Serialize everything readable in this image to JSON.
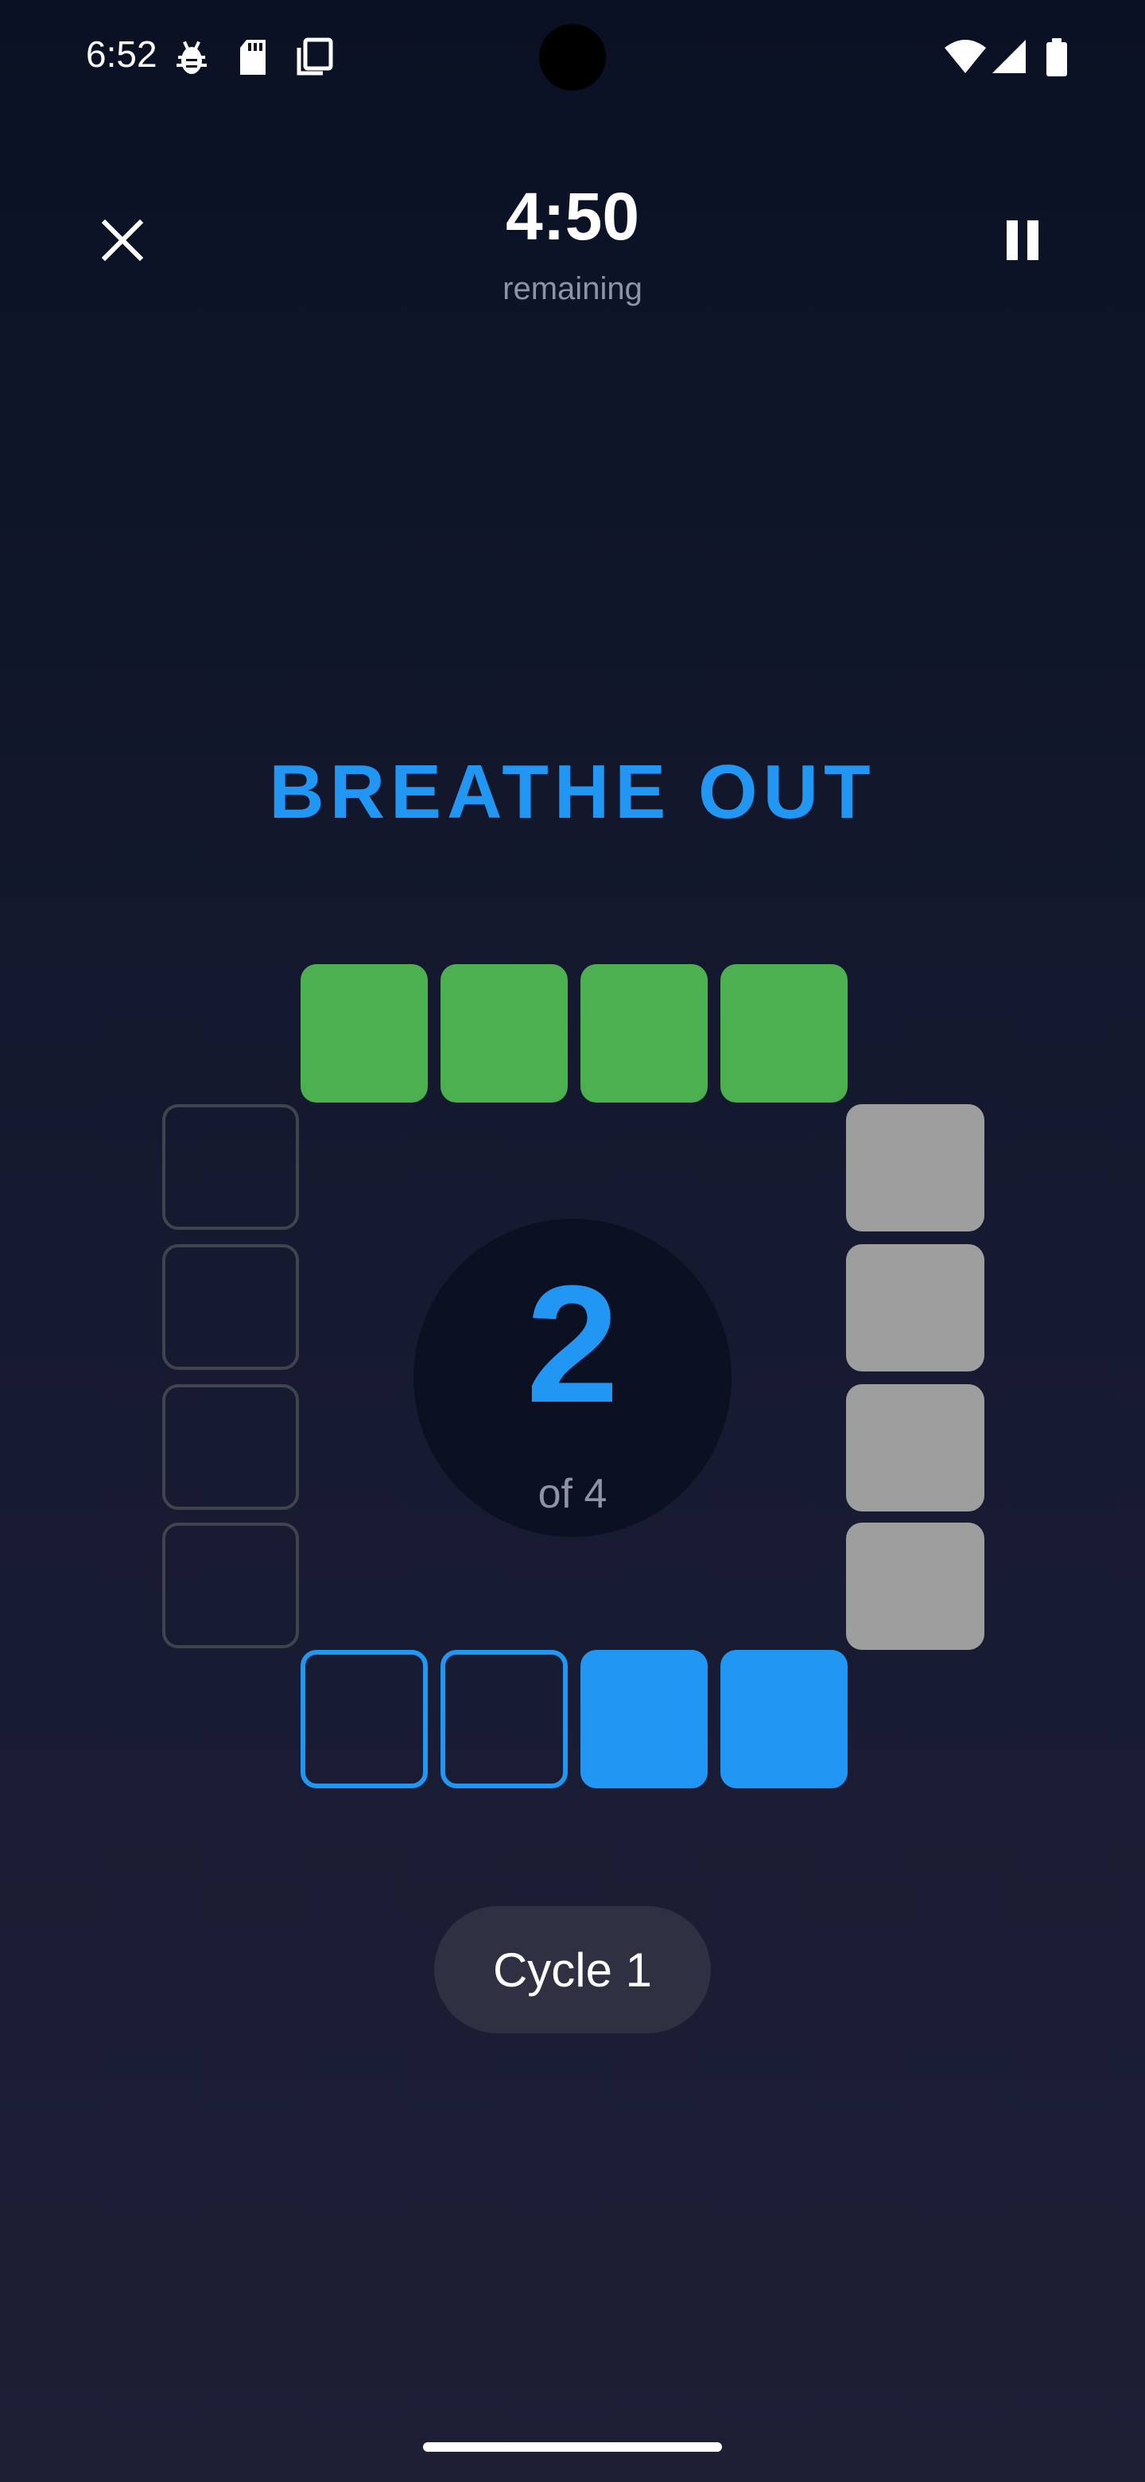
{
  "status_bar": {
    "time": "6:52",
    "icons": [
      "bug-icon",
      "sd-card-icon",
      "copy-icon",
      "wifi-icon",
      "signal-icon",
      "battery-icon"
    ]
  },
  "header": {
    "close_icon": "close-icon",
    "pause_icon": "pause-icon",
    "timer": "4:50",
    "timer_caption": "remaining"
  },
  "phase": {
    "label": "BREATHE OUT",
    "color": "#2196f3"
  },
  "breathing_box": {
    "top_side": {
      "state": "complete",
      "color": "#4caf50",
      "count": 4
    },
    "right_side": {
      "state": "complete",
      "color": "#9e9e9e",
      "count": 4
    },
    "bottom_side": {
      "state": "active",
      "color": "#2196f3",
      "filled": 2,
      "count": 4
    },
    "left_side": {
      "state": "pending",
      "count": 4
    }
  },
  "counter": {
    "value": "2",
    "total_label": "of 4"
  },
  "cycle": {
    "label": "Cycle 1"
  },
  "colors": {
    "accent": "#2196f3",
    "inhale": "#4caf50",
    "hold": "#9e9e9e",
    "background": "#121628"
  }
}
